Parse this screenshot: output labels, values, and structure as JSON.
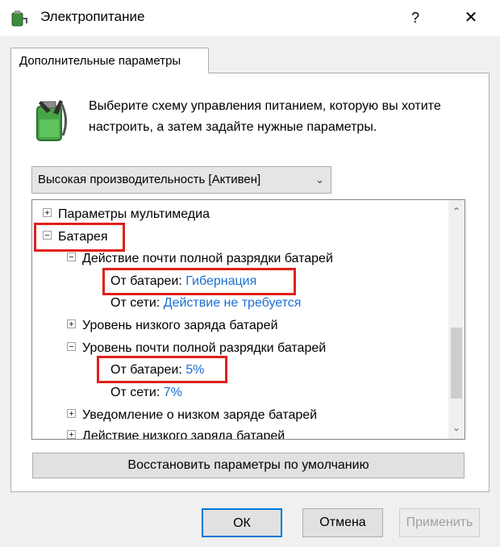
{
  "window": {
    "title": "Электропитание",
    "help_label": "?",
    "close_label": "✕"
  },
  "tab": {
    "label": "Дополнительные параметры"
  },
  "description": "Выберите схему управления питанием, которую вы хотите настроить, а затем задайте нужные параметры.",
  "plan_select": {
    "value": "Высокая производительность [Активен]"
  },
  "tree": {
    "multimedia": "Параметры мультимедиа",
    "battery": "Батарея",
    "critical_action": {
      "label": "Действие почти полной разрядки батарей",
      "on_battery_label": "От батареи:",
      "on_battery_value": "Гибернация",
      "plugged_in_label": "От сети:",
      "plugged_in_value": "Действие не требуется"
    },
    "low_level": "Уровень низкого заряда батарей",
    "critical_level": {
      "label": "Уровень почти полной разрядки батарей",
      "on_battery_label": "От батареи:",
      "on_battery_value": "5%",
      "plugged_in_label": "От сети:",
      "plugged_in_value": "7%"
    },
    "low_notification": "Уведомление о низком заряде батарей",
    "low_action": "Действие низкого заряда батарей"
  },
  "buttons": {
    "restore": "Восстановить параметры по умолчанию",
    "ok": "ОК",
    "cancel": "Отмена",
    "apply": "Применить"
  },
  "colors": {
    "highlight": "#e0201c",
    "value_link": "#1a6fd1",
    "accent": "#0078d7"
  }
}
